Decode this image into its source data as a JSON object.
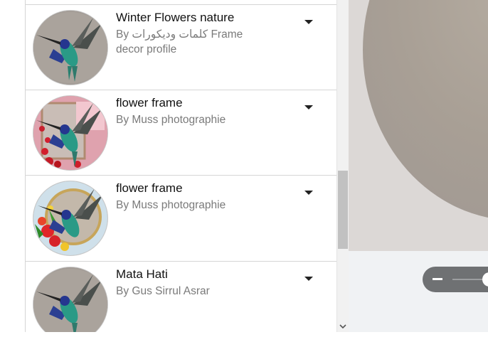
{
  "frames": [
    {
      "title": "Winter Flowers nature",
      "author": "By كلمات وديكورات Frame decor profile",
      "style": "plain"
    },
    {
      "title": "flower frame",
      "author": "By Muss photographie",
      "style": "roses"
    },
    {
      "title": "flower frame",
      "author": "By Muss photographie",
      "style": "hibiscus"
    },
    {
      "title": "Mata Hati",
      "author": "By Gus Sirrul Asrar",
      "style": "plain"
    }
  ],
  "icons": {
    "options": "caret-down-icon",
    "thumbnail": "hummingbird-image",
    "scroll_down": "chevron-down-icon",
    "zoom_out": "minus-icon"
  },
  "colors": {
    "text_primary": "#111111",
    "text_secondary": "#7a7a7a",
    "zoom_bar": "#6f7173",
    "hummingbird_head": "#2a3e9c",
    "hummingbird_body": "#2a9a86"
  }
}
